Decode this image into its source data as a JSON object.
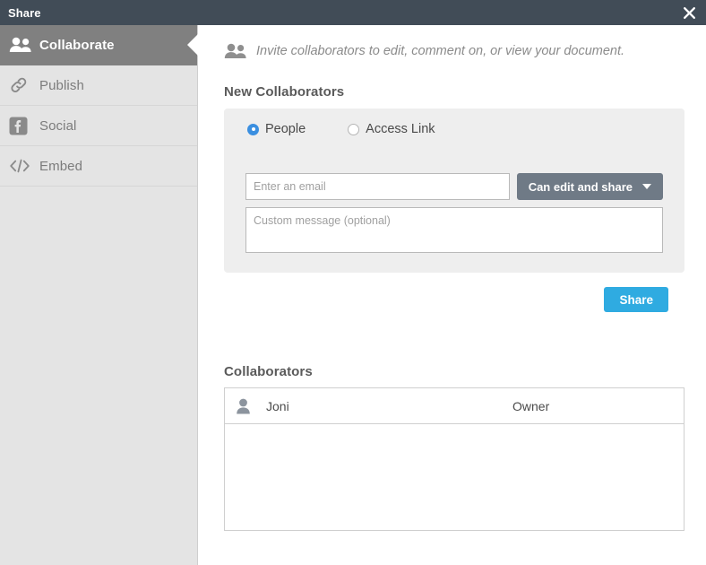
{
  "window": {
    "title": "Share",
    "close_icon": "close-icon"
  },
  "sidebar": {
    "items": [
      {
        "label": "Collaborate",
        "icon": "people-icon",
        "active": true
      },
      {
        "label": "Publish",
        "icon": "link-icon",
        "active": false
      },
      {
        "label": "Social",
        "icon": "facebook-icon",
        "active": false
      },
      {
        "label": "Embed",
        "icon": "code-icon",
        "active": false
      }
    ]
  },
  "main": {
    "invite": {
      "icon": "people-icon",
      "text": "Invite collaborators to edit, comment on, or view your document."
    },
    "new_collaborators": {
      "heading": "New Collaborators",
      "radios": [
        {
          "label": "People",
          "checked": true
        },
        {
          "label": "Access Link",
          "checked": false
        }
      ],
      "email_field": {
        "placeholder": "Enter an email",
        "value": ""
      },
      "permission_button": {
        "label": "Can edit and share",
        "icon": "chevron-down-icon"
      },
      "message_field": {
        "placeholder": "Custom message (optional)",
        "value": ""
      },
      "share_button": "Share"
    },
    "collaborators": {
      "heading": "Collaborators",
      "rows": [
        {
          "icon": "person-icon",
          "name": "Joni",
          "role": "Owner"
        }
      ]
    }
  },
  "colors": {
    "titlebar": "#414c57",
    "sidebar_bg": "#e4e4e4",
    "sidebar_active": "#808080",
    "panel_bg": "#eeeeee",
    "accent_blue": "#2fabe1",
    "radio_blue": "#3b8fe0",
    "permission_gray": "#6f7a86"
  }
}
